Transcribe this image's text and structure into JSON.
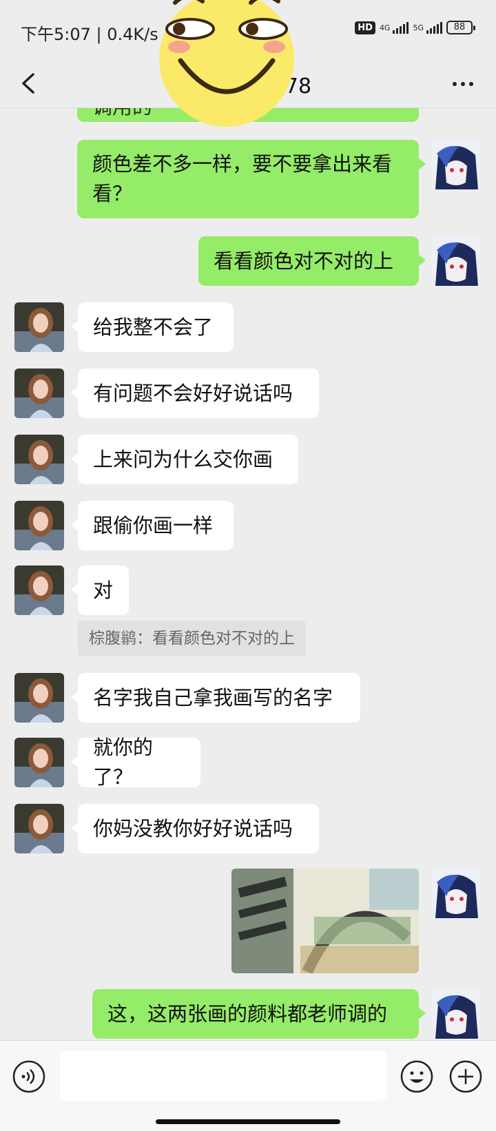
{
  "status_bar": {
    "time": "下午5:07 | 0.4K/s",
    "hd": "HD",
    "net_4g": "4G",
    "net_5g": "5G",
    "battery": "88"
  },
  "header": {
    "title": "三班 751278"
  },
  "messages": [
    {
      "side": "out",
      "text": "颜色差不多一样，要不要拿出来看看？"
    },
    {
      "side": "out",
      "text": "看看颜色对不对的上"
    },
    {
      "side": "in",
      "text": "给我整不会了"
    },
    {
      "side": "in",
      "text": "有问题不会好好说话吗"
    },
    {
      "side": "in",
      "text": "上来问为什么交你画"
    },
    {
      "side": "in",
      "text": "跟偷你画一样"
    },
    {
      "side": "in",
      "text": "对"
    },
    {
      "side": "quote",
      "text": "棕腹鹟：看看颜色对不对的上"
    },
    {
      "side": "in",
      "text": "名字我自己拿我画写的名字"
    },
    {
      "side": "in",
      "text": "就你的了？"
    },
    {
      "side": "in",
      "text": "你妈没教你好好说话吗"
    },
    {
      "side": "out",
      "type": "image",
      "icon": "watercolor-painting-photo"
    },
    {
      "side": "out",
      "text": "这，这两张画的颜料都老师调的"
    }
  ],
  "partial_top_message": "调用的",
  "input_bar": {
    "placeholder": "",
    "voice_icon": "voice-icon",
    "emoji_icon": "emoji-icon",
    "plus_icon": "plus-icon"
  },
  "colors": {
    "outgoing_bubble": "#95ec69",
    "incoming_bubble": "#ffffff",
    "background": "#ededed"
  }
}
